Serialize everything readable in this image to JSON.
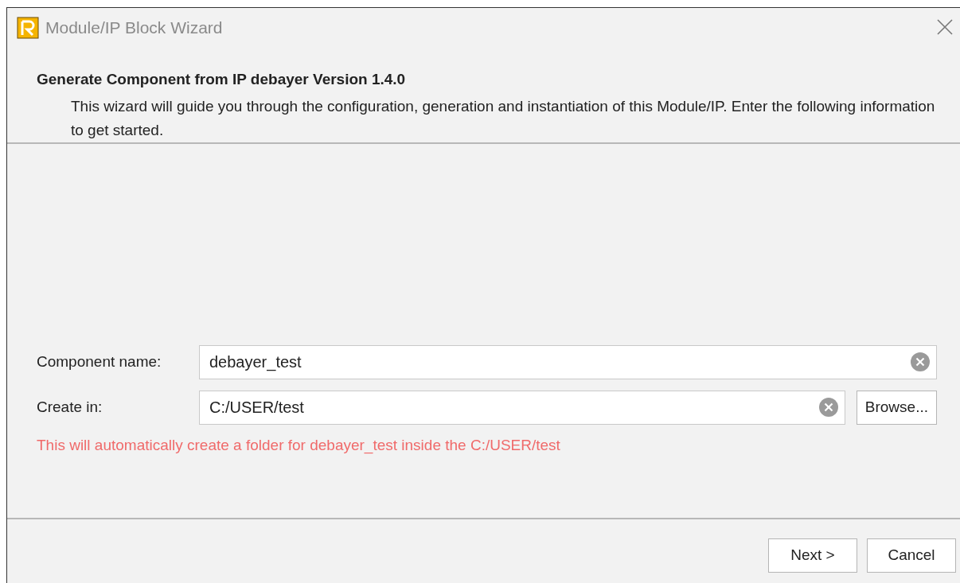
{
  "window": {
    "title": "Module/IP Block Wizard"
  },
  "header": {
    "title": "Generate Component from IP debayer Version 1.4.0",
    "description": "This wizard will guide you through the configuration, generation and instantiation of this Module/IP. Enter the following information to get started."
  },
  "fields": [
    {
      "label": "Component name:",
      "value": "debayer_test"
    },
    {
      "label": "Create in:",
      "value": "C:/USER/test",
      "button": "Browse..."
    }
  ],
  "note": "This will automatically create a folder for debayer_test inside the C:/USER/test",
  "buttons": [
    "Next >",
    "Cancel"
  ]
}
